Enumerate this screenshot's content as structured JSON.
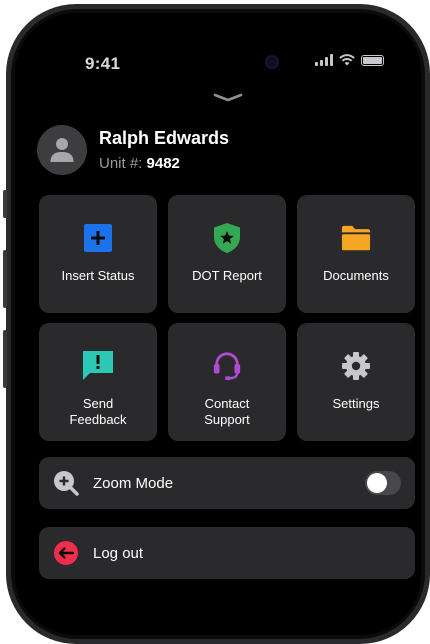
{
  "status_bar": {
    "time": "9:41"
  },
  "profile": {
    "name": "Ralph Edwards",
    "unit_label": "Unit #:",
    "unit_number": "9482"
  },
  "tiles": [
    {
      "label": "Insert Status",
      "icon": "plus-square-icon",
      "color": "#1a73e8"
    },
    {
      "label": "DOT Report",
      "icon": "shield-star-icon",
      "color": "#34a853"
    },
    {
      "label": "Documents",
      "icon": "folder-icon",
      "color": "#f5a623"
    },
    {
      "label": "Send\nFeedback",
      "icon": "feedback-icon",
      "color": "#2bc8b6"
    },
    {
      "label": "Contact\nSupport",
      "icon": "headset-icon",
      "color": "#b14bd6"
    },
    {
      "label": "Settings",
      "icon": "gear-icon",
      "color": "#c7c7cc"
    }
  ],
  "zoom_mode": {
    "label": "Zoom Mode",
    "enabled": false
  },
  "logout": {
    "label": "Log out",
    "color": "#f02d4b"
  }
}
